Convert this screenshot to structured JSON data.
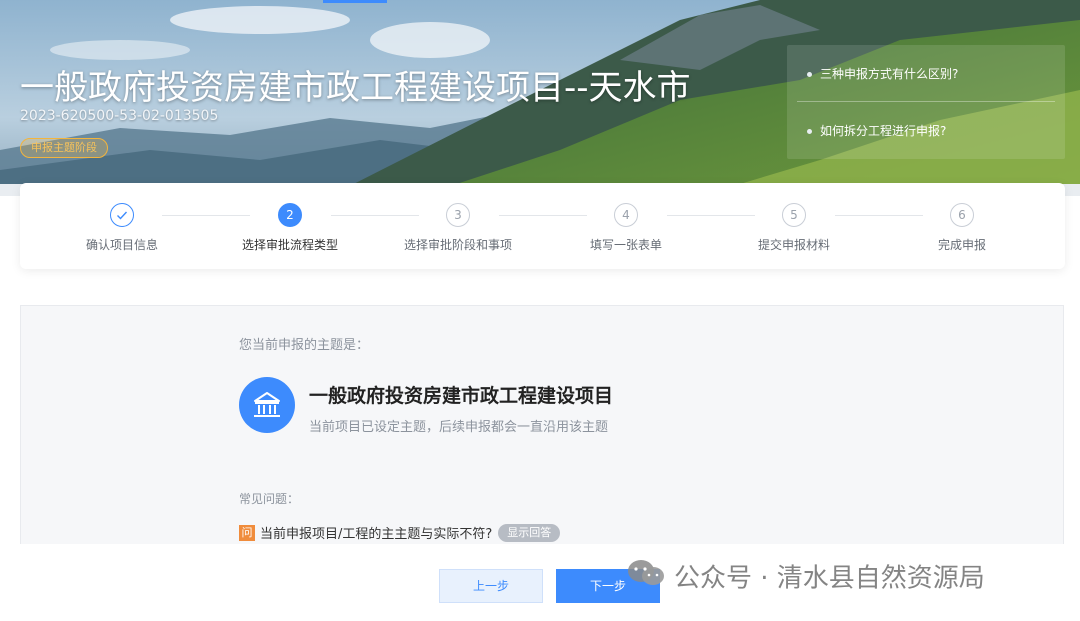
{
  "banner": {
    "title": "一般政府投资房建市政工程建设项目--天水市",
    "code": "2023-620500-53-02-013505",
    "stage_badge": "申报主题阶段",
    "faq": [
      "三种申报方式有什么区别?",
      "如何拆分工程进行申报?"
    ]
  },
  "steps": [
    {
      "number": "",
      "label": "确认项目信息",
      "state": "done"
    },
    {
      "number": "2",
      "label": "选择审批流程类型",
      "state": "active"
    },
    {
      "number": "3",
      "label": "选择审批阶段和事项",
      "state": "pending"
    },
    {
      "number": "4",
      "label": "填写一张表单",
      "state": "pending"
    },
    {
      "number": "5",
      "label": "提交申报材料",
      "state": "pending"
    },
    {
      "number": "6",
      "label": "完成申报",
      "state": "pending"
    }
  ],
  "main": {
    "topic_hint": "您当前申报的主题是：",
    "topic_title": "一般政府投资房建市政工程建设项目",
    "topic_desc": "当前项目已设定主题，后续申报都会一直沿用该主题",
    "common_questions_title": "常见问题：",
    "question_tag": "问",
    "question_text": "当前申报项目/工程的主主题与实际不符?",
    "show_answer_label": "显示回答"
  },
  "footer": {
    "prev_label": "上一步",
    "next_label": "下一步",
    "watermark": "公众号 · 清水县自然资源局"
  },
  "colors": {
    "primary": "#3d8bfd",
    "badge": "#f3b53d",
    "question_tag": "#f08c3c"
  },
  "icons": {
    "step_done": "check-icon",
    "topic": "government-building-icon",
    "faq_bullet": "dot-icon",
    "watermark": "wechat-icon"
  }
}
